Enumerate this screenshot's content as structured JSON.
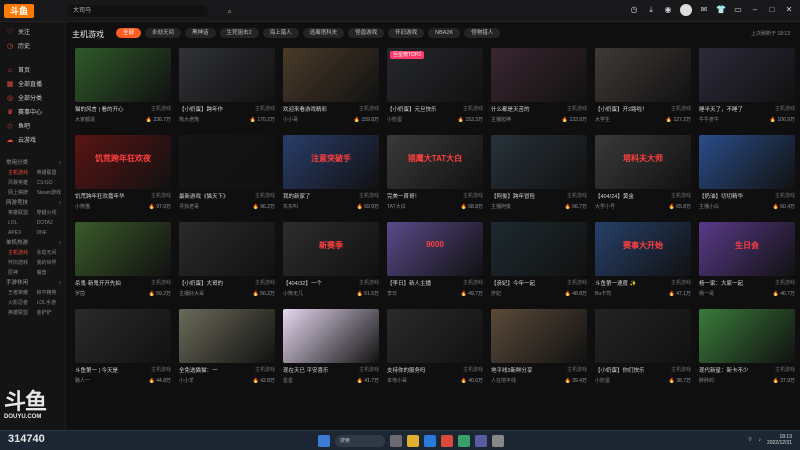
{
  "topbar": {
    "logo": "斗鱼",
    "search_value": "大司马",
    "search_icon": "search-icon",
    "icons": [
      "history-icon",
      "download-icon",
      "record-icon",
      "user-avatar",
      "message-icon",
      "skin-icon",
      "window-icon",
      "minimize-icon",
      "maximize-icon",
      "close-icon"
    ]
  },
  "sidebar": {
    "items": [
      {
        "label": "关注",
        "icon": "heart-icon"
      },
      {
        "label": "历史",
        "icon": "history-icon"
      },
      {
        "label": "首页",
        "icon": "home-icon"
      },
      {
        "label": "全部直播",
        "icon": "grid-icon"
      },
      {
        "label": "全部分类",
        "icon": "category-icon"
      },
      {
        "label": "赛事中心",
        "icon": "trophy-icon"
      },
      {
        "label": "鱼吧",
        "icon": "fish-icon"
      },
      {
        "label": "云游戏",
        "icon": "cloud-icon"
      }
    ],
    "sections": [
      {
        "title": "常用分类",
        "links": [
          "主机游戏",
          "英雄联盟",
          "风暴英雄",
          "CS:GO",
          "网上棋牌",
          "Steam游戏"
        ]
      },
      {
        "title": "网游竞技",
        "links": [
          "英雄联盟",
          "穿越火线",
          "LOL",
          "DOTA2",
          "APEX",
          "DNF"
        ]
      },
      {
        "title": "单机热游",
        "links": [
          "主机游戏",
          "永劫无间",
          "怀旧游戏",
          "我的世界",
          "原神",
          "魔兽"
        ]
      },
      {
        "title": "手游休闲",
        "links": [
          "王者荣耀",
          "和平精英",
          "火影忍者",
          "LOL手游",
          "英雄联盟",
          "金铲铲"
        ]
      }
    ],
    "active_link": "主机游戏",
    "watermark_big": "斗鱼",
    "watermark_small": "DOUYU.COM"
  },
  "content": {
    "category_title": "主机游戏",
    "tabs": [
      {
        "label": "全部",
        "active": true
      },
      {
        "label": "永劫无间",
        "active": false
      },
      {
        "label": "黑神话",
        "active": false
      },
      {
        "label": "生死狙击2",
        "active": false
      },
      {
        "label": "海上猎人",
        "active": false
      },
      {
        "label": "逃离塔科夫",
        "active": false
      },
      {
        "label": "怪兽游戏",
        "active": false
      },
      {
        "label": "怀旧游戏",
        "active": false
      },
      {
        "label": "NBA2K",
        "active": false
      },
      {
        "label": "怪物猎人",
        "active": false
      }
    ],
    "sort_label": "上次刷新于 18:13",
    "cards": [
      {
        "title": "猫的风言 | 看的开心",
        "category": "主机游戏",
        "streamer": "大家都说",
        "hot": "236.7万",
        "bg": "#2f5a2a",
        "text": ""
      },
      {
        "title": "【小奶蛋】跨年作",
        "category": "主机游戏",
        "streamer": "熊大老熊",
        "hot": "170.2万",
        "bg": "#303236",
        "text": ""
      },
      {
        "title": "欢迎来看游戏精彩",
        "category": "主机游戏",
        "streamer": "小小哥",
        "hot": "159.8万",
        "bg": "#4a3b2a",
        "text": ""
      },
      {
        "title": "【小奶蛋】元旦快乐",
        "category": "主机游戏",
        "streamer": "小奶蛋",
        "hot": "153.3万",
        "bg": "#26282c",
        "text": "",
        "tag": "巨星榜TOP3"
      },
      {
        "title": "什么都是天苦的",
        "category": "主机游戏",
        "streamer": "主播旭神",
        "hot": "133.9万",
        "bg": "#3a2630",
        "text": ""
      },
      {
        "title": "【小奶蛋】开2路啦！",
        "category": "主机游戏",
        "streamer": "大学生",
        "hot": "127.2万",
        "bg": "#403a36",
        "text": ""
      },
      {
        "title": "睡半天了，不睡了",
        "category": "主机游戏",
        "streamer": "牛牛老牛",
        "hot": "106.9万",
        "bg": "#2c2a3a",
        "text": ""
      },
      {
        "title": "饥荒跨年狂欢嘉年华",
        "category": "主机游戏",
        "streamer": "小熊猫",
        "hot": "97.9万",
        "bg": "#5a1414",
        "text": "饥荒跨年狂欢夜"
      },
      {
        "title": "最新游戏《猫天下》",
        "category": "主机游戏",
        "streamer": "寻找老哥",
        "hot": "96.2万",
        "bg": "#151515",
        "text": ""
      },
      {
        "title": "我的新家了",
        "category": "主机游戏",
        "streamer": "东东叫",
        "hot": "69.9万",
        "bg": "#2a3d6a",
        "text": "注意突破手"
      },
      {
        "title": "完美一首哥！",
        "category": "主机游戏",
        "streamer": "TAT大白",
        "hot": "68.8万",
        "bg": "#3a3a3a",
        "text": "猎鹰大TAT大白"
      },
      {
        "title": "【阿俊】跨年冒险",
        "category": "主机游戏",
        "streamer": "主播阿俊",
        "hot": "66.7万",
        "bg": "#27323a",
        "text": ""
      },
      {
        "title": "【404/24】黄金",
        "category": "主机游戏",
        "streamer": "大学小号",
        "hot": "65.8万",
        "bg": "#3a3a3c",
        "text": "塔科夫大师"
      },
      {
        "title": "【奶油】切切精华",
        "category": "主机游戏",
        "streamer": "主播小白",
        "hot": "60.4万",
        "bg": "#2a4d8a",
        "text": ""
      },
      {
        "title": "杀鬼·新鬼开开先拍",
        "category": "主机游戏",
        "streamer": "罗茵",
        "hot": "59.2万",
        "bg": "#3a5a2a",
        "text": ""
      },
      {
        "title": "【小奶蛋】大哥的",
        "category": "主机游戏",
        "streamer": "主播好大哥",
        "hot": "56.2万",
        "bg": "#2a2a2a",
        "text": ""
      },
      {
        "title": "【404/32】一个",
        "category": "主机游戏",
        "streamer": "小熊无几",
        "hot": "51.5万",
        "bg": "#2d2d2d",
        "text": "新赛季"
      },
      {
        "title": "【李日】新人主播",
        "category": "主机游戏",
        "streamer": "李日",
        "hot": "49.7万",
        "bg": "#5a4a8a",
        "text": "9000"
      },
      {
        "title": "【彦妃】今年一起",
        "category": "主机游戏",
        "streamer": "彦妃",
        "hot": "48.8万",
        "bg": "#1d2a30",
        "text": ""
      },
      {
        "title": "斗鱼第一速度 ✨",
        "category": "主机游戏",
        "streamer": "Bu卡司",
        "hot": "47.1万",
        "bg": "#27406a",
        "text": "赛事大开始"
      },
      {
        "title": "杨一家：大家一起",
        "category": "主机游戏",
        "streamer": "杨一哥",
        "hot": "46.7万",
        "bg": "#5a3a8a",
        "text": "生日会"
      },
      {
        "title": "斗鱼第一 | 今天是",
        "category": "主机游戏",
        "streamer": "路人一",
        "hot": "44.8万",
        "bg": "#2a2a2a",
        "text": ""
      },
      {
        "title": "全免选猫猫：一",
        "category": "主机游戏",
        "streamer": "小小羊",
        "hot": "42.8万",
        "bg": "#6a6a5a",
        "text": ""
      },
      {
        "title": "现在天已 平安喜乐",
        "category": "主机游戏",
        "streamer": "星星",
        "hot": "41.7万",
        "bg": "#e6d8f0",
        "text": ""
      },
      {
        "title": "支持你的服务吗",
        "category": "主机游戏",
        "streamer": "本地小哥",
        "hot": "40.6万",
        "bg": "#2a2a2a",
        "text": ""
      },
      {
        "title": "地平线3新鲜分享",
        "category": "主机游戏",
        "streamer": "人在地平线",
        "hot": "39.4万",
        "bg": "#5a4a3a",
        "text": ""
      },
      {
        "title": "【小奶蛋】你们快乐",
        "category": "主机游戏",
        "streamer": "小奶蛋",
        "hot": "38.7万",
        "bg": "#232323",
        "text": ""
      },
      {
        "title": "现代新星：新卡不少",
        "category": "主机游戏",
        "streamer": "胖胖的",
        "hot": "37.9万",
        "bg": "#3a7a3a",
        "text": ""
      }
    ]
  },
  "taskbar": {
    "stream_id": "314740",
    "search_placeholder": "搜索",
    "time": "18:13",
    "date": "2022/12/31"
  }
}
